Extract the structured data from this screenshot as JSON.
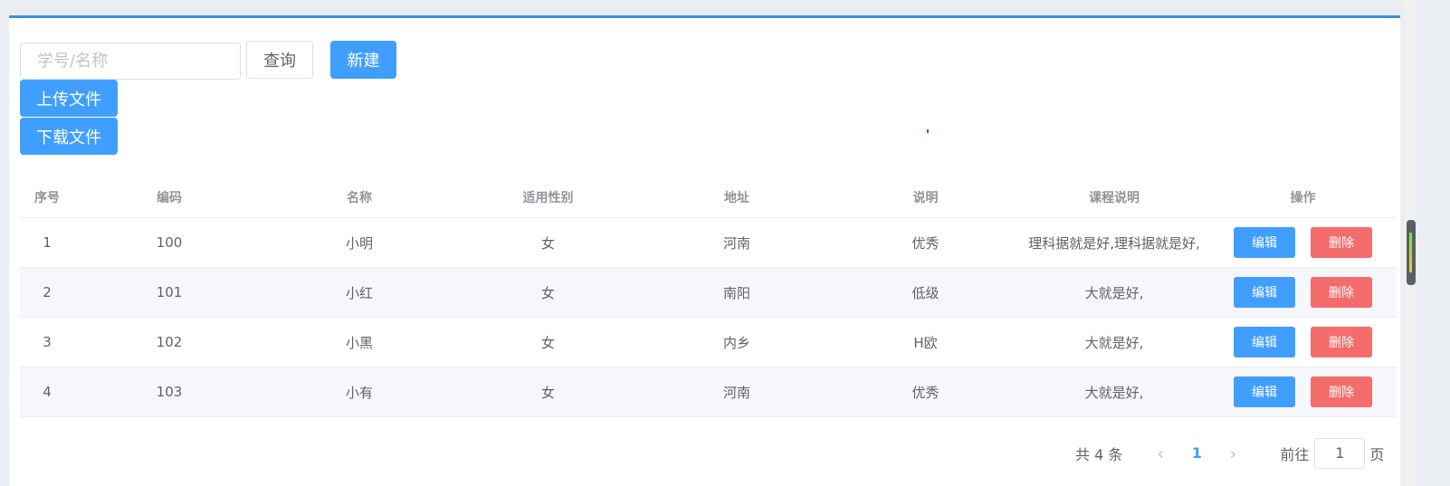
{
  "toolbar": {
    "search_placeholder": "学号/名称",
    "query_label": "查询",
    "new_label": "新建",
    "upload_label": "上传文件",
    "download_label": "下载文件"
  },
  "table": {
    "headers": [
      "序号",
      "编码",
      "名称",
      "适用性别",
      "地址",
      "说明",
      "课程说明",
      "操作"
    ],
    "edit_label": "编辑",
    "delete_label": "删除",
    "rows": [
      [
        "1",
        "100",
        "小明",
        "女",
        "河南",
        "优秀",
        "理科据就是好,理科据就是好,"
      ],
      [
        "2",
        "101",
        "小红",
        "女",
        "南阳",
        "低级",
        "大就是好,"
      ],
      [
        "3",
        "102",
        "小黑",
        "女",
        "内乡",
        "H欧",
        "大就是好,"
      ],
      [
        "4",
        "103",
        "小有",
        "女",
        "河南",
        "优秀",
        "大就是好,"
      ]
    ]
  },
  "pagination": {
    "total_text": "共 4 条",
    "prev_icon": "chevron-left-icon",
    "current_page": "1",
    "next_icon": "chevron-right-icon",
    "goto_label": "前往",
    "goto_value": "1",
    "goto_suffix": "页"
  },
  "colors": {
    "primary": "#409eff",
    "danger": "#f56c6c",
    "accent_border": "#3a8ee6",
    "stripe": "#f5f7fa"
  }
}
